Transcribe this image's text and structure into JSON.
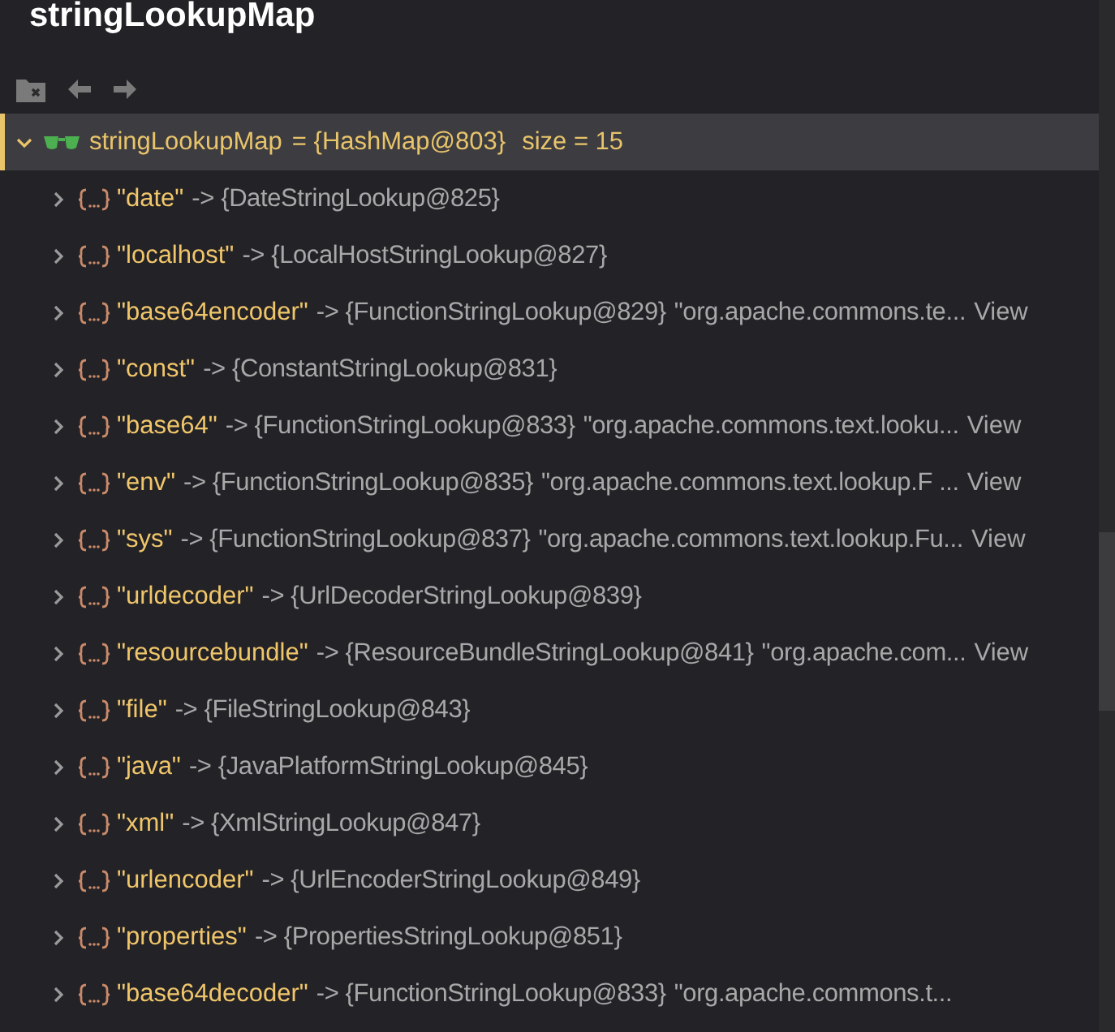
{
  "title": "stringLookupMap",
  "root": {
    "name": "stringLookupMap",
    "value": "= {HashMap@803}",
    "size": "size = 15",
    "expanded": true,
    "selected": true
  },
  "entries": [
    {
      "key": "\"date\"",
      "value": "-> {DateStringLookup@825}"
    },
    {
      "key": "\"localhost\"",
      "value": "-> {LocalHostStringLookup@827}"
    },
    {
      "key": "\"base64encoder\"",
      "value": "-> {FunctionStringLookup@829}",
      "detail": "\"org.apache.commons.te...",
      "link": "View"
    },
    {
      "key": "\"const\"",
      "value": "-> {ConstantStringLookup@831}"
    },
    {
      "key": "\"base64\"",
      "value": "-> {FunctionStringLookup@833}",
      "detail": "\"org.apache.commons.text.looku...",
      "link": "View"
    },
    {
      "key": "\"env\"",
      "value": "-> {FunctionStringLookup@835}",
      "detail": "\"org.apache.commons.text.lookup.F ...",
      "link": "View"
    },
    {
      "key": "\"sys\"",
      "value": "-> {FunctionStringLookup@837}",
      "detail": "\"org.apache.commons.text.lookup.Fu...",
      "link": "View"
    },
    {
      "key": "\"urldecoder\"",
      "value": "-> {UrlDecoderStringLookup@839}"
    },
    {
      "key": "\"resourcebundle\"",
      "value": "-> {ResourceBundleStringLookup@841}",
      "detail": "\"org.apache.com...",
      "link": "View"
    },
    {
      "key": "\"file\"",
      "value": "-> {FileStringLookup@843}"
    },
    {
      "key": "\"java\"",
      "value": "-> {JavaPlatformStringLookup@845}"
    },
    {
      "key": "\"xml\"",
      "value": "-> {XmlStringLookup@847}"
    },
    {
      "key": "\"urlencoder\"",
      "value": "-> {UrlEncoderStringLookup@849}"
    },
    {
      "key": "\"properties\"",
      "value": "-> {PropertiesStringLookup@851}"
    },
    {
      "key": "\"base64decoder\"",
      "value": "-> {FunctionStringLookup@833}",
      "detail": "\"org.apache.commons.t..."
    }
  ]
}
